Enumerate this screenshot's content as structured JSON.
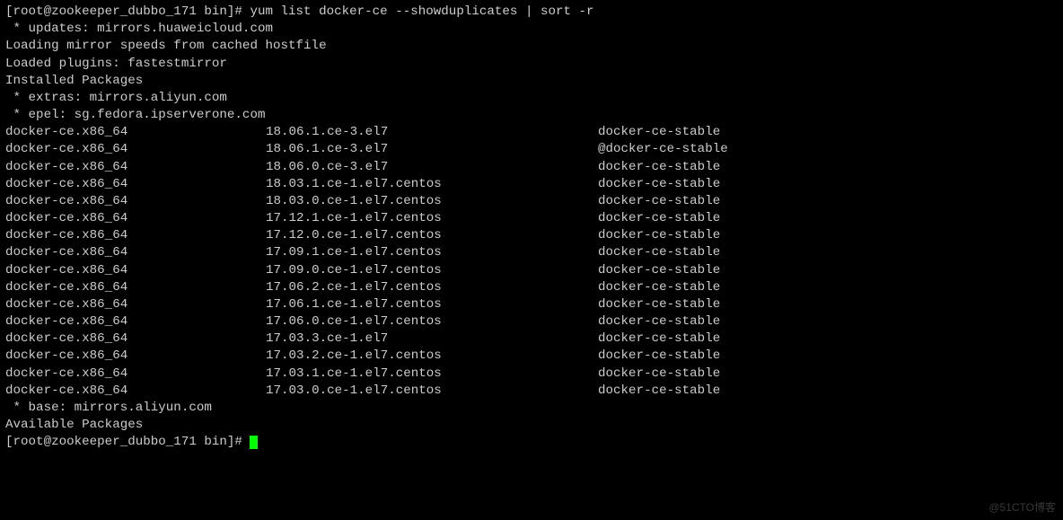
{
  "prompt": {
    "user": "root",
    "host": "zookeeper_dubbo_171",
    "cwd": "bin",
    "command": "yum list docker-ce --showduplicates | sort -r"
  },
  "header_lines": [
    " * updates: mirrors.huaweicloud.com",
    "Loading mirror speeds from cached hostfile",
    "Loaded plugins: fastestmirror",
    "Installed Packages",
    " * extras: mirrors.aliyun.com",
    " * epel: sg.fedora.ipserverone.com"
  ],
  "packages": [
    {
      "name": "docker-ce.x86_64",
      "version": "18.06.1.ce-3.el7",
      "repo": "docker-ce-stable"
    },
    {
      "name": "docker-ce.x86_64",
      "version": "18.06.1.ce-3.el7",
      "repo": "@docker-ce-stable"
    },
    {
      "name": "docker-ce.x86_64",
      "version": "18.06.0.ce-3.el7",
      "repo": "docker-ce-stable"
    },
    {
      "name": "docker-ce.x86_64",
      "version": "18.03.1.ce-1.el7.centos",
      "repo": "docker-ce-stable"
    },
    {
      "name": "docker-ce.x86_64",
      "version": "18.03.0.ce-1.el7.centos",
      "repo": "docker-ce-stable"
    },
    {
      "name": "docker-ce.x86_64",
      "version": "17.12.1.ce-1.el7.centos",
      "repo": "docker-ce-stable"
    },
    {
      "name": "docker-ce.x86_64",
      "version": "17.12.0.ce-1.el7.centos",
      "repo": "docker-ce-stable"
    },
    {
      "name": "docker-ce.x86_64",
      "version": "17.09.1.ce-1.el7.centos",
      "repo": "docker-ce-stable"
    },
    {
      "name": "docker-ce.x86_64",
      "version": "17.09.0.ce-1.el7.centos",
      "repo": "docker-ce-stable"
    },
    {
      "name": "docker-ce.x86_64",
      "version": "17.06.2.ce-1.el7.centos",
      "repo": "docker-ce-stable"
    },
    {
      "name": "docker-ce.x86_64",
      "version": "17.06.1.ce-1.el7.centos",
      "repo": "docker-ce-stable"
    },
    {
      "name": "docker-ce.x86_64",
      "version": "17.06.0.ce-1.el7.centos",
      "repo": "docker-ce-stable"
    },
    {
      "name": "docker-ce.x86_64",
      "version": "17.03.3.ce-1.el7",
      "repo": "docker-ce-stable"
    },
    {
      "name": "docker-ce.x86_64",
      "version": "17.03.2.ce-1.el7.centos",
      "repo": "docker-ce-stable"
    },
    {
      "name": "docker-ce.x86_64",
      "version": "17.03.1.ce-1.el7.centos",
      "repo": "docker-ce-stable"
    },
    {
      "name": "docker-ce.x86_64",
      "version": "17.03.0.ce-1.el7.centos",
      "repo": "docker-ce-stable"
    }
  ],
  "footer_lines": [
    " * base: mirrors.aliyun.com",
    "Available Packages"
  ],
  "watermark": "@51CTO博客"
}
